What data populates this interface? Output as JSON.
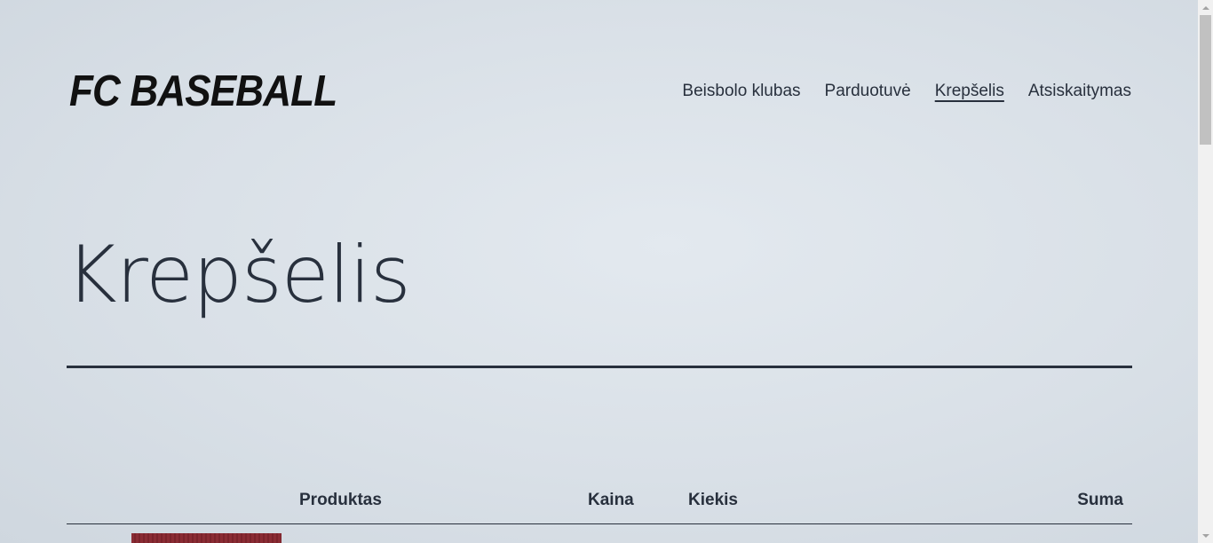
{
  "header": {
    "logo_text": "FC BASEBALL",
    "nav": [
      {
        "label": "Beisbolo klubas"
      },
      {
        "label": "Parduotuvė"
      },
      {
        "label": "Krepšelis",
        "current": true
      },
      {
        "label": "Atsiskaitymas"
      }
    ]
  },
  "main": {
    "title": "Krepšelis",
    "cart_table": {
      "columns": [
        "Produktas",
        "Kaina",
        "Kiekis",
        "Suma"
      ]
    }
  },
  "colors": {
    "text": "#28303d",
    "background": "#d9e0e7",
    "product_thumb": "#8a2c34"
  }
}
